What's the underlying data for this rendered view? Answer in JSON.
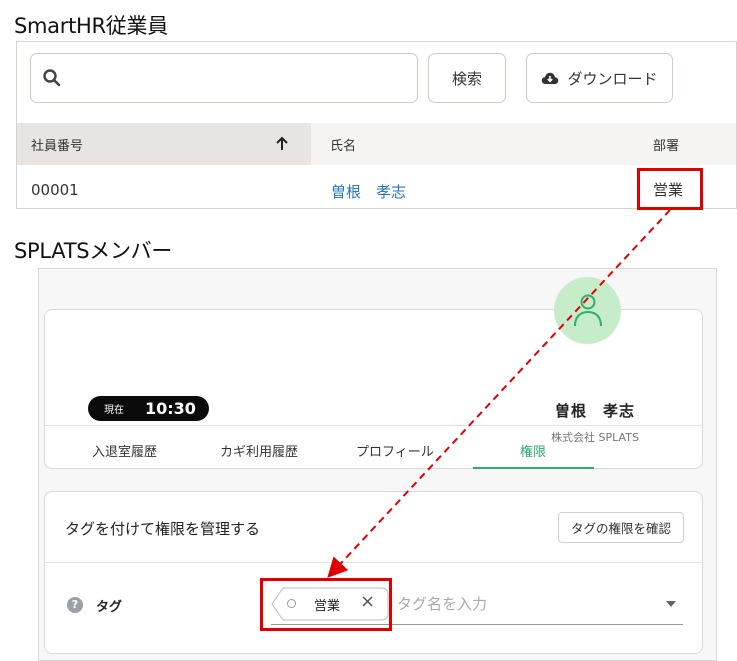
{
  "labels": {
    "smarthr_heading": "SmartHR従業員",
    "splats_heading": "SPLATSメンバー"
  },
  "smarthr": {
    "search": {
      "value": "",
      "placeholder": ""
    },
    "search_button": "検索",
    "download_button": "ダウンロード",
    "table": {
      "columns": [
        "社員番号",
        "氏名",
        "部署"
      ],
      "sorted_column": "社員番号",
      "sort_direction": "asc",
      "rows": [
        {
          "employee_id": "00001",
          "name": "曽根　孝志",
          "department": "営業"
        }
      ]
    }
  },
  "splats": {
    "profile": {
      "now_label": "現在",
      "time": "10:30",
      "name": "曽根　孝志",
      "company": "株式会社 SPLATS"
    },
    "tabs": [
      {
        "label": "入退室履歴",
        "active": false
      },
      {
        "label": "カギ利用履歴",
        "active": false
      },
      {
        "label": "プロフィール",
        "active": false
      },
      {
        "label": "権限",
        "active": true
      }
    ],
    "permissions": {
      "title": "タグを付けて権限を管理する",
      "check_button": "タグの権限を確認",
      "help_icon": "?",
      "tag_label": "タグ",
      "tags": [
        "営業"
      ],
      "input_placeholder": "タグ名を入力"
    }
  },
  "colors": {
    "highlight": "#e00000",
    "accent_green": "#2fae6b",
    "link_blue": "#2a74b8",
    "avatar_bg": "#c7ecc9"
  },
  "icons": {
    "search": "search-icon",
    "download": "cloud-download-icon",
    "sort": "arrow-up-icon",
    "avatar": "person-icon",
    "help": "question-circle-icon",
    "tag_remove": "close-icon",
    "dropdown": "caret-down-icon"
  }
}
